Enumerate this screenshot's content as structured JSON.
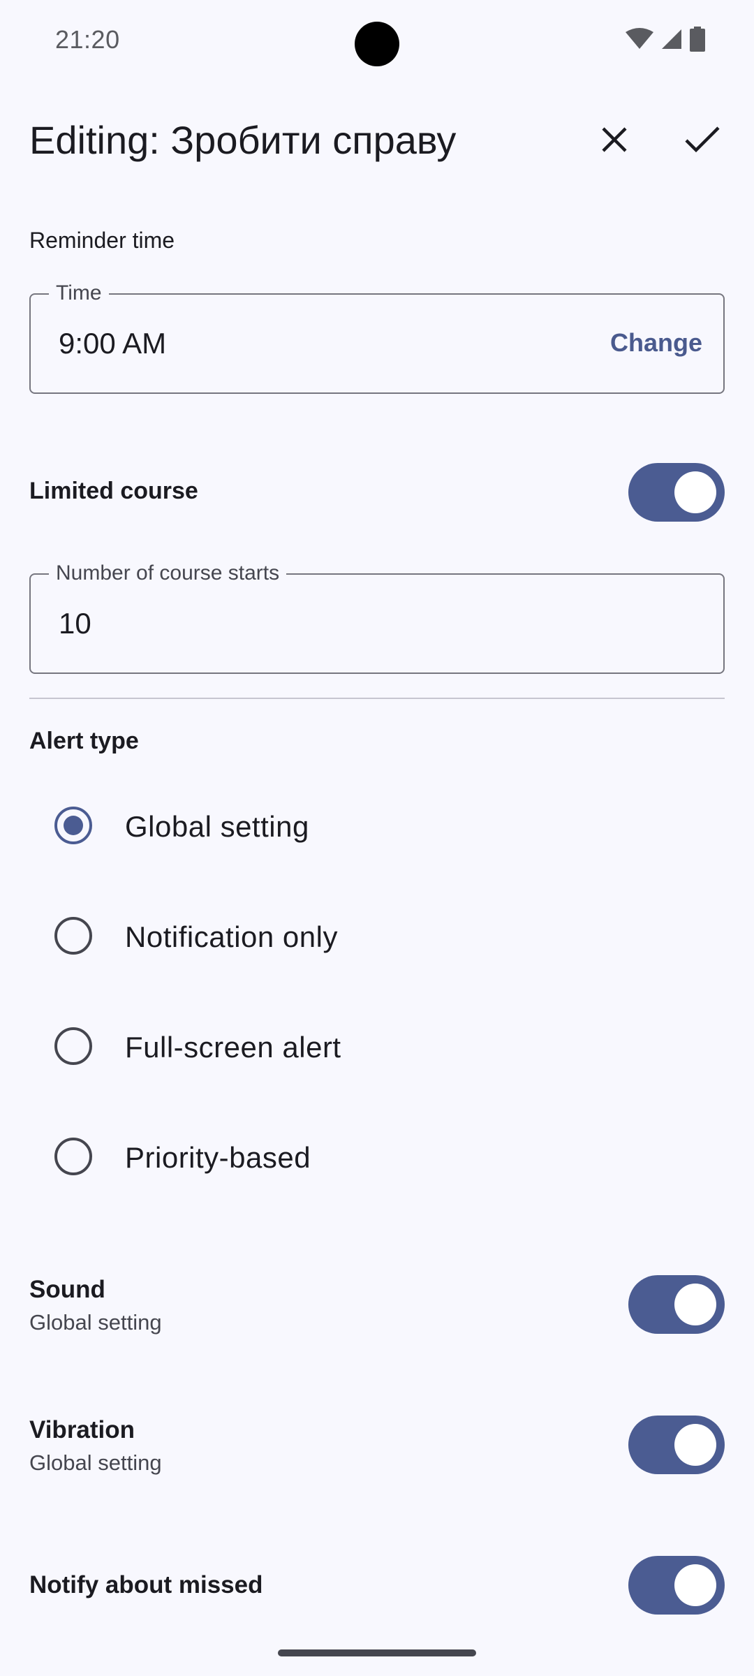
{
  "status_bar": {
    "time": "21:20",
    "icons": [
      "wifi-icon",
      "signal-icon",
      "battery-icon"
    ]
  },
  "app_bar": {
    "title": "Editing: Зробити справу",
    "close_icon": "close-icon",
    "confirm_icon": "check-icon"
  },
  "reminder": {
    "section_label": "Reminder time",
    "field_label": "Time",
    "value": "9:00 AM",
    "change_label": "Change"
  },
  "limited_course": {
    "label": "Limited course",
    "enabled": true,
    "field_label": "Number of course starts",
    "value": "10"
  },
  "alert_type": {
    "title": "Alert type",
    "options": [
      {
        "label": "Global setting",
        "selected": true
      },
      {
        "label": "Notification only",
        "selected": false
      },
      {
        "label": "Full-screen alert",
        "selected": false
      },
      {
        "label": "Priority-based",
        "selected": false
      }
    ]
  },
  "sound": {
    "title": "Sound",
    "subtitle": "Global setting",
    "enabled": true
  },
  "vibration": {
    "title": "Vibration",
    "subtitle": "Global setting",
    "enabled": true
  },
  "notify_missed": {
    "title": "Notify about missed",
    "enabled": true
  },
  "colors": {
    "accent": "#4b5c92",
    "background": "#f8f8fe",
    "outline": "#76767f"
  }
}
